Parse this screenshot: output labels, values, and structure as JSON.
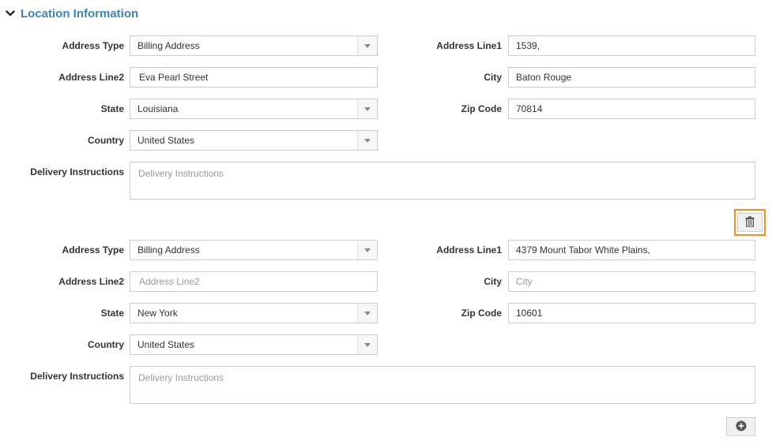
{
  "section": {
    "title": "Location Information",
    "expanded": true
  },
  "addresses": [
    {
      "address_type": {
        "label": "Address Type",
        "value": "Billing Address"
      },
      "address_line1": {
        "label": "Address Line1",
        "value": "1539,"
      },
      "address_line2": {
        "label": "Address Line2",
        "value": "Eva Pearl Street",
        "placeholder": "Address Line2"
      },
      "city": {
        "label": "City",
        "value": "Baton Rouge",
        "placeholder": "City"
      },
      "state": {
        "label": "State",
        "value": "Louisiana"
      },
      "zip_code": {
        "label": "Zip Code",
        "value": "70814"
      },
      "country": {
        "label": "Country",
        "value": "United States"
      },
      "delivery_instructions": {
        "label": "Delivery Instructions",
        "value": "",
        "placeholder": "Delivery Instructions"
      }
    },
    {
      "address_type": {
        "label": "Address Type",
        "value": "Billing Address"
      },
      "address_line1": {
        "label": "Address Line1",
        "value": "4379 Mount Tabor White Plains,"
      },
      "address_line2": {
        "label": "Address Line2",
        "value": "",
        "placeholder": "Address Line2"
      },
      "city": {
        "label": "City",
        "value": "",
        "placeholder": "City"
      },
      "state": {
        "label": "State",
        "value": "New York"
      },
      "zip_code": {
        "label": "Zip Code",
        "value": "10601"
      },
      "country": {
        "label": "Country",
        "value": "United States"
      },
      "delivery_instructions": {
        "label": "Delivery Instructions",
        "value": "",
        "placeholder": "Delivery Instructions"
      }
    }
  ],
  "actions": {
    "delete_icon": "trash-icon",
    "add_icon": "plus-circle-icon",
    "highlight_color": "#f0901e"
  },
  "colors": {
    "accent": "#3b83c0",
    "text": "#333333",
    "placeholder": "#999999",
    "border": "#cccccc"
  }
}
